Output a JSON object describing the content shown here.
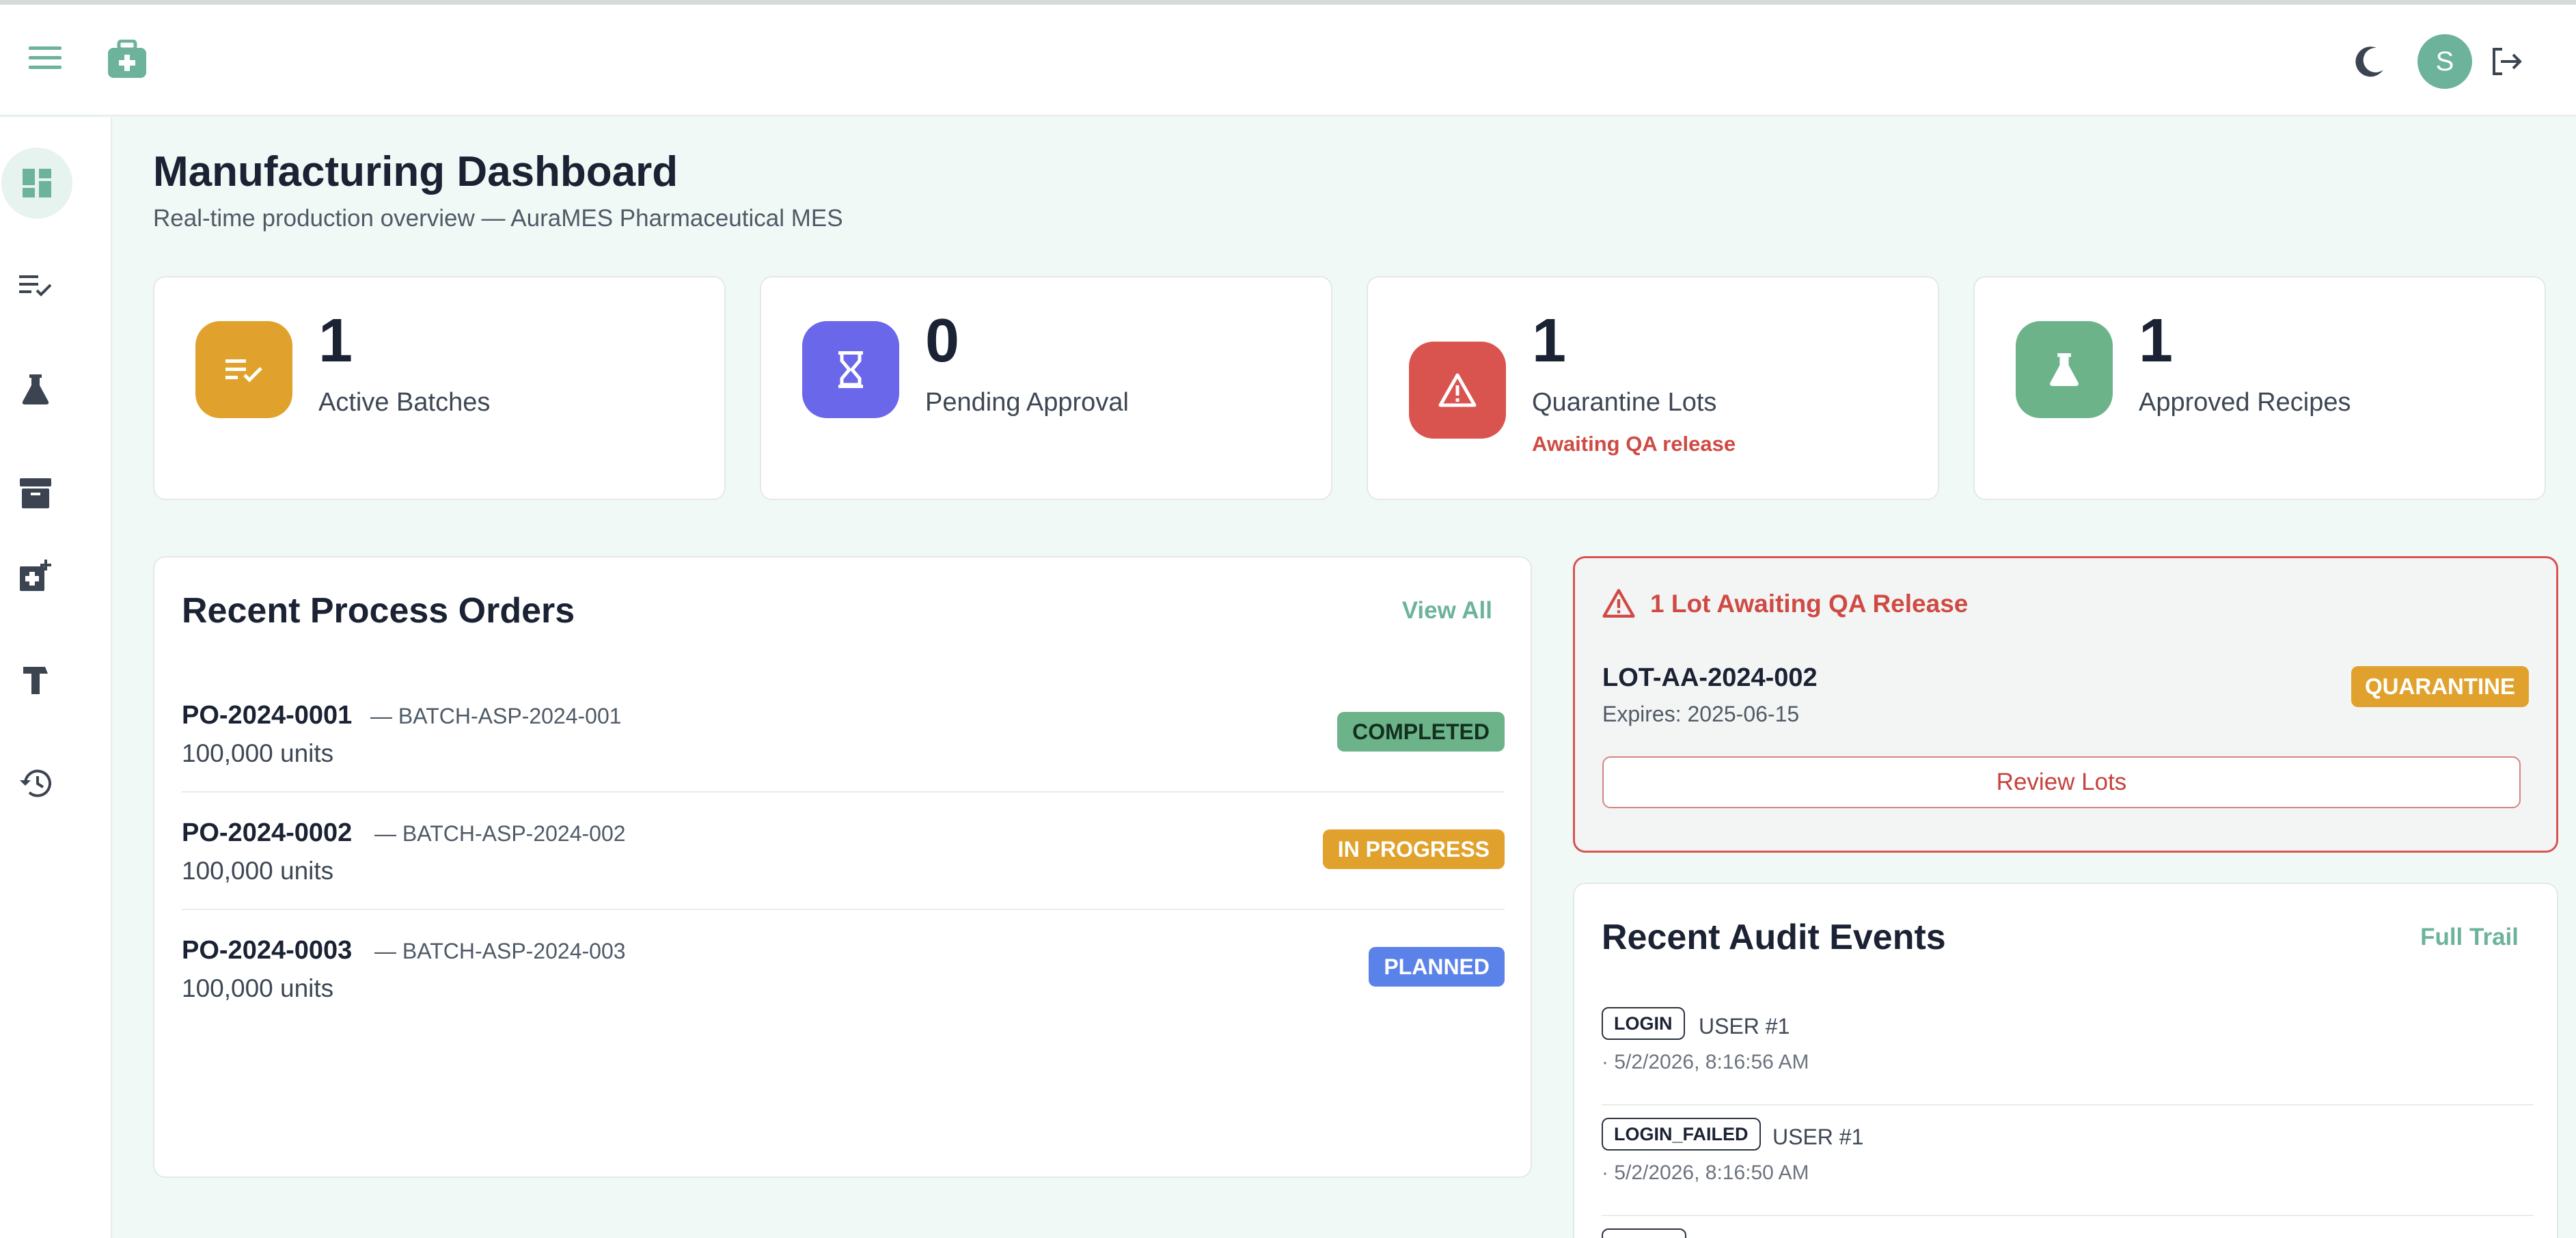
{
  "header": {
    "avatar_initial": "S",
    "icons": [
      "menu-icon",
      "medical-kit-icon",
      "moon-icon",
      "logout-icon"
    ]
  },
  "sidebar": {
    "items": [
      {
        "name": "dashboard",
        "icon": "dashboard-icon",
        "active": true
      },
      {
        "name": "process-orders",
        "icon": "checklist-icon",
        "active": false
      },
      {
        "name": "recipes",
        "icon": "flask-icon",
        "active": false
      },
      {
        "name": "inventory",
        "icon": "archive-icon",
        "active": false
      },
      {
        "name": "materials",
        "icon": "medical-add-icon",
        "active": false
      },
      {
        "name": "equipment",
        "icon": "hammer-icon",
        "active": false
      },
      {
        "name": "audit-trail",
        "icon": "history-icon",
        "active": false
      }
    ]
  },
  "page": {
    "title": "Manufacturing Dashboard",
    "subtitle": "Real-time production overview — AuraMES Pharmaceutical MES"
  },
  "kpis": [
    {
      "value": "1",
      "label": "Active Batches",
      "note": "",
      "color": "#e0a22c",
      "icon": "checklist-icon"
    },
    {
      "value": "0",
      "label": "Pending Approval",
      "note": "",
      "color": "#6a67ea",
      "icon": "hourglass-icon"
    },
    {
      "value": "1",
      "label": "Quarantine Lots",
      "note": "Awaiting QA release",
      "color": "#d9534f",
      "icon": "warning-icon"
    },
    {
      "value": "1",
      "label": "Approved Recipes",
      "note": "",
      "color": "#6db38a",
      "icon": "flask-icon"
    }
  ],
  "process_orders": {
    "title": "Recent Process Orders",
    "view_all": "View All",
    "rows": [
      {
        "id": "PO-2024-0001",
        "batch": "— BATCH-ASP-2024-001",
        "qty": "100,000 units",
        "status": "COMPLETED",
        "status_bg": "#6db38a",
        "status_fg": "#13301f"
      },
      {
        "id": "PO-2024-0002",
        "batch": "— BATCH-ASP-2024-002",
        "qty": "100,000 units",
        "status": "IN PROGRESS",
        "status_bg": "#e0a22c",
        "status_fg": "#ffffff"
      },
      {
        "id": "PO-2024-0003",
        "batch": "— BATCH-ASP-2024-003",
        "qty": "100,000 units",
        "status": "PLANNED",
        "status_bg": "#5b82e8",
        "status_fg": "#ffffff"
      }
    ]
  },
  "qa_alert": {
    "title": "1 Lot Awaiting QA Release",
    "lot_id": "LOT-AA-2024-002",
    "expires": "Expires: 2025-06-15",
    "status": "QUARANTINE",
    "button": "Review Lots"
  },
  "audit": {
    "title": "Recent Audit Events",
    "full_trail": "Full Trail",
    "events": [
      {
        "action": "LOGIN",
        "user": "USER #1",
        "time": "· 5/2/2026, 8:16:56 AM"
      },
      {
        "action": "LOGIN_FAILED",
        "user": "USER #1",
        "time": "· 5/2/2026, 8:16:50 AM"
      }
    ]
  }
}
